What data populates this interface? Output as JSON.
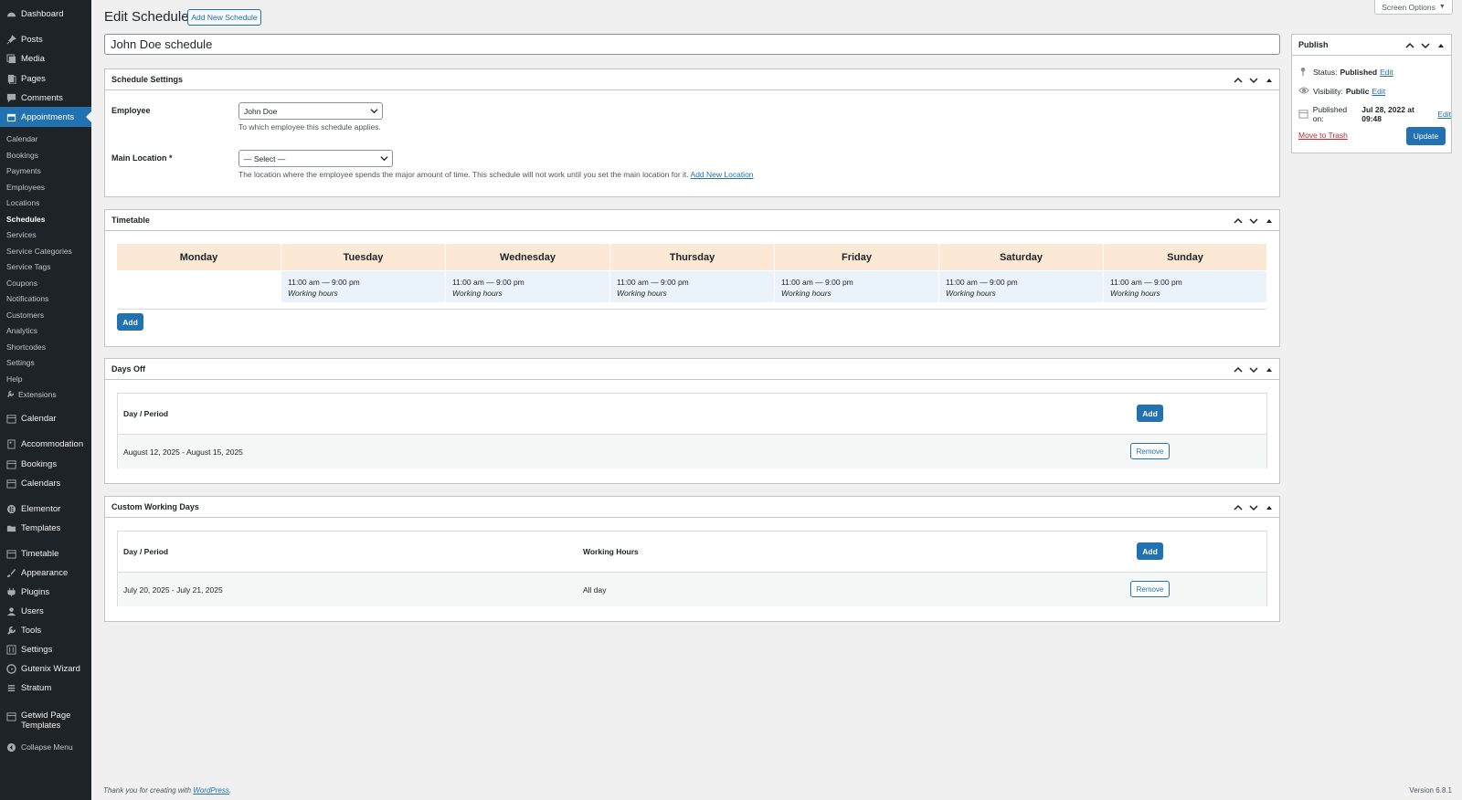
{
  "sidebar": {
    "top": [
      {
        "label": "Dashboard",
        "icon": "dashboard-icon"
      },
      {
        "label": "Posts",
        "icon": "pin-icon"
      },
      {
        "label": "Media",
        "icon": "media-icon"
      },
      {
        "label": "Pages",
        "icon": "pages-icon"
      },
      {
        "label": "Comments",
        "icon": "comments-icon"
      },
      {
        "label": "Appointments",
        "icon": "calendar-icon"
      }
    ],
    "submenu": [
      "Calendar",
      "Bookings",
      "Payments",
      "Employees",
      "Locations",
      "Schedules",
      "Services",
      "Service Categories",
      "Service Tags",
      "Coupons",
      "Notifications",
      "Customers",
      "Analytics",
      "Shortcodes",
      "Settings",
      "Help",
      "Extensions"
    ],
    "bottom": [
      {
        "label": "Calendar",
        "icon": "calendar-icon"
      },
      {
        "label": "Accommodation",
        "icon": "building-icon"
      },
      {
        "label": "Bookings",
        "icon": "calendar-icon"
      },
      {
        "label": "Calendars",
        "icon": "calendar-icon"
      },
      {
        "label": "Elementor",
        "icon": "elementor-icon"
      },
      {
        "label": "Templates",
        "icon": "folder-icon"
      },
      {
        "label": "Timetable",
        "icon": "calendar-icon"
      },
      {
        "label": "Appearance",
        "icon": "brush-icon"
      },
      {
        "label": "Plugins",
        "icon": "plugin-icon"
      },
      {
        "label": "Users",
        "icon": "users-icon"
      },
      {
        "label": "Tools",
        "icon": "wrench-icon"
      },
      {
        "label": "Settings",
        "icon": "settings-icon"
      },
      {
        "label": "Gutenix Wizard",
        "icon": "gutenix-icon"
      },
      {
        "label": "Stratum",
        "icon": "stratum-icon"
      },
      {
        "label": "Getwid Page Templates",
        "icon": "calendar-icon"
      },
      {
        "label": "Collapse Menu",
        "icon": "collapse-icon"
      }
    ]
  },
  "header": {
    "title": "Edit Schedule",
    "add_new": "Add New Schedule",
    "screen_options": "Screen Options"
  },
  "post_title": "John Doe schedule",
  "schedule_settings": {
    "title": "Schedule Settings",
    "employee_label": "Employee",
    "employee_value": "John Doe",
    "employee_desc": "To which employee this schedule applies.",
    "location_label": "Main Location *",
    "location_value": "— Select —",
    "location_desc": "The location where the employee spends the major amount of time. This schedule will not work until you set the main location for it.",
    "add_location_link": "Add New Location"
  },
  "timetable": {
    "title": "Timetable",
    "days": [
      "Monday",
      "Tuesday",
      "Wednesday",
      "Thursday",
      "Friday",
      "Saturday",
      "Sunday"
    ],
    "slots": [
      "",
      "11:00 am — 9:00 pm",
      "11:00 am — 9:00 pm",
      "11:00 am — 9:00 pm",
      "11:00 am — 9:00 pm",
      "11:00 am — 9:00 pm",
      "11:00 am — 9:00 pm"
    ],
    "slot_type": [
      "",
      "Working hours",
      "Working hours",
      "Working hours",
      "Working hours",
      "Working hours",
      "Working hours"
    ],
    "add_label": "Add"
  },
  "days_off": {
    "title": "Days Off",
    "col_period": "Day / Period",
    "add_label": "Add",
    "row_period": "August 12, 2025 - August 15, 2025",
    "remove_label": "Remove"
  },
  "custom_days": {
    "title": "Custom Working Days",
    "col_period": "Day / Period",
    "col_hours": "Working Hours",
    "add_label": "Add",
    "row_period": "July 20, 2025 - July 21, 2025",
    "row_hours": "All day",
    "remove_label": "Remove"
  },
  "publish": {
    "title": "Publish",
    "status_label": "Status:",
    "status_value": "Published",
    "visibility_label": "Visibility:",
    "visibility_value": "Public",
    "published_label": "Published on:",
    "published_value": "Jul 28, 2022 at 09:48",
    "edit": "Edit",
    "trash": "Move to Trash",
    "update": "Update"
  },
  "footer": {
    "thanks_prefix": "Thank you for creating with",
    "wp_link": "WordPress",
    "thanks_suffix": ".",
    "version": "Version 6.8.1"
  },
  "colors": {
    "sidebar_bg": "#1d2327",
    "accent": "#2271b1",
    "timetable_header": "#fbe9d6",
    "timetable_cell": "#eaf2fa",
    "trash": "#b32d2e"
  }
}
